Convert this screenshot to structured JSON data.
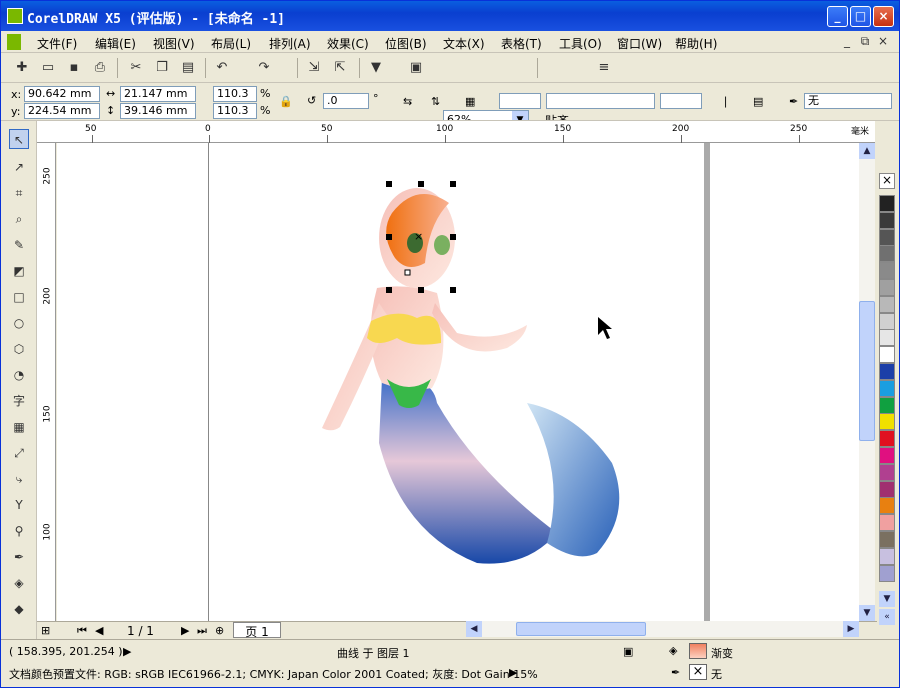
{
  "window": {
    "title": "CorelDRAW X5 (评估版) - [未命名 -1]",
    "min": "_",
    "max": "□",
    "close": "×"
  },
  "menu": [
    "文件(F)",
    "编辑(E)",
    "视图(V)",
    "布局(L)",
    "排列(A)",
    "效果(C)",
    "位图(B)",
    "文本(X)",
    "表格(T)",
    "工具(O)",
    "窗口(W)",
    "帮助(H)"
  ],
  "mdi": {
    "min": "_",
    "restore": "⧉",
    "close": "×"
  },
  "toolbar": {
    "zoom": "62%",
    "snap": "贴齐"
  },
  "props": {
    "x_label": "x:",
    "y_label": "y:",
    "x": "90.642 mm",
    "y": "224.54 mm",
    "w": "21.147 mm",
    "h": "39.146 mm",
    "sx": "110.3",
    "sy": "110.3",
    "pct": "%",
    "rot": ".0",
    "deg": "°",
    "outline": "无"
  },
  "ruler_top": [
    "50",
    "0",
    "50",
    "100",
    "150",
    "200",
    "250"
  ],
  "ruler_top_unit": "毫米",
  "ruler_left": [
    "250",
    "200",
    "150",
    "100"
  ],
  "pages": {
    "count": "1 / 1",
    "tab": "页 1"
  },
  "status": {
    "coords": "( 158.395, 201.254 )",
    "object": "曲线 于 图层 1",
    "profile": "文档颜色预置文件: RGB: sRGB IEC61966-2.1; CMYK: Japan Color 2001 Coated; 灰度: Dot Gain 15%",
    "fill": "渐变",
    "outline": "无"
  },
  "palette": [
    "#222222",
    "#3a3a3a",
    "#555555",
    "#707070",
    "#8a8a8a",
    "#a0a0a0",
    "#b8b8b8",
    "#d0d0d0",
    "#e6e6e6",
    "#ffffff",
    "#1c3fa8",
    "#1a9ee0",
    "#10a040",
    "#f0e000",
    "#e01020",
    "#e01080",
    "#b04090",
    "#a03070",
    "#e88010",
    "#f0a0a0",
    "#7a7060",
    "#c8c0e0",
    "#a0a0d0"
  ]
}
